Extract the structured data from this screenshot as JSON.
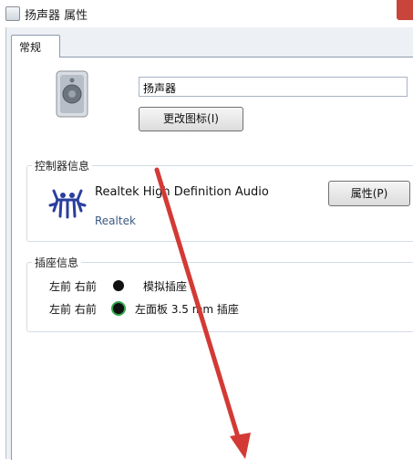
{
  "window": {
    "title": "扬声器 属性"
  },
  "tabs": [
    {
      "label": "常规",
      "selected": true
    }
  ],
  "device": {
    "name": "扬声器",
    "change_icon_label": "更改图标(I)"
  },
  "controller": {
    "group_title": "控制器信息",
    "name": "Realtek High Definition Audio",
    "vendor": "Realtek",
    "properties_label": "属性(P)"
  },
  "jacks": {
    "group_title": "插座信息",
    "rows": [
      {
        "position": "左前 右前",
        "description": "模拟插座",
        "color": "#111111"
      },
      {
        "position": "左前 右前",
        "description": "左面板 3.5 mm 插座",
        "color": "#2fa84a"
      }
    ]
  },
  "colors": {
    "accent": "#d33a35",
    "link": "#3b5a84",
    "close": "#c9453b"
  }
}
